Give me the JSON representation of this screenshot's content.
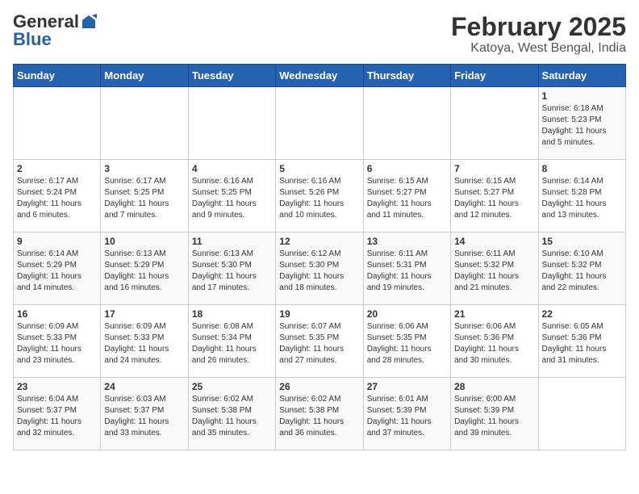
{
  "logo": {
    "general": "General",
    "blue": "Blue"
  },
  "title": "February 2025",
  "subtitle": "Katoya, West Bengal, India",
  "days_header": [
    "Sunday",
    "Monday",
    "Tuesday",
    "Wednesday",
    "Thursday",
    "Friday",
    "Saturday"
  ],
  "weeks": [
    [
      {
        "day": "",
        "info": ""
      },
      {
        "day": "",
        "info": ""
      },
      {
        "day": "",
        "info": ""
      },
      {
        "day": "",
        "info": ""
      },
      {
        "day": "",
        "info": ""
      },
      {
        "day": "",
        "info": ""
      },
      {
        "day": "1",
        "info": "Sunrise: 6:18 AM\nSunset: 5:23 PM\nDaylight: 11 hours\nand 5 minutes."
      }
    ],
    [
      {
        "day": "2",
        "info": "Sunrise: 6:17 AM\nSunset: 5:24 PM\nDaylight: 11 hours\nand 6 minutes."
      },
      {
        "day": "3",
        "info": "Sunrise: 6:17 AM\nSunset: 5:25 PM\nDaylight: 11 hours\nand 7 minutes."
      },
      {
        "day": "4",
        "info": "Sunrise: 6:16 AM\nSunset: 5:25 PM\nDaylight: 11 hours\nand 9 minutes."
      },
      {
        "day": "5",
        "info": "Sunrise: 6:16 AM\nSunset: 5:26 PM\nDaylight: 11 hours\nand 10 minutes."
      },
      {
        "day": "6",
        "info": "Sunrise: 6:15 AM\nSunset: 5:27 PM\nDaylight: 11 hours\nand 11 minutes."
      },
      {
        "day": "7",
        "info": "Sunrise: 6:15 AM\nSunset: 5:27 PM\nDaylight: 11 hours\nand 12 minutes."
      },
      {
        "day": "8",
        "info": "Sunrise: 6:14 AM\nSunset: 5:28 PM\nDaylight: 11 hours\nand 13 minutes."
      }
    ],
    [
      {
        "day": "9",
        "info": "Sunrise: 6:14 AM\nSunset: 5:29 PM\nDaylight: 11 hours\nand 14 minutes."
      },
      {
        "day": "10",
        "info": "Sunrise: 6:13 AM\nSunset: 5:29 PM\nDaylight: 11 hours\nand 16 minutes."
      },
      {
        "day": "11",
        "info": "Sunrise: 6:13 AM\nSunset: 5:30 PM\nDaylight: 11 hours\nand 17 minutes."
      },
      {
        "day": "12",
        "info": "Sunrise: 6:12 AM\nSunset: 5:30 PM\nDaylight: 11 hours\nand 18 minutes."
      },
      {
        "day": "13",
        "info": "Sunrise: 6:11 AM\nSunset: 5:31 PM\nDaylight: 11 hours\nand 19 minutes."
      },
      {
        "day": "14",
        "info": "Sunrise: 6:11 AM\nSunset: 5:32 PM\nDaylight: 11 hours\nand 21 minutes."
      },
      {
        "day": "15",
        "info": "Sunrise: 6:10 AM\nSunset: 5:32 PM\nDaylight: 11 hours\nand 22 minutes."
      }
    ],
    [
      {
        "day": "16",
        "info": "Sunrise: 6:09 AM\nSunset: 5:33 PM\nDaylight: 11 hours\nand 23 minutes."
      },
      {
        "day": "17",
        "info": "Sunrise: 6:09 AM\nSunset: 5:33 PM\nDaylight: 11 hours\nand 24 minutes."
      },
      {
        "day": "18",
        "info": "Sunrise: 6:08 AM\nSunset: 5:34 PM\nDaylight: 11 hours\nand 26 minutes."
      },
      {
        "day": "19",
        "info": "Sunrise: 6:07 AM\nSunset: 5:35 PM\nDaylight: 11 hours\nand 27 minutes."
      },
      {
        "day": "20",
        "info": "Sunrise: 6:06 AM\nSunset: 5:35 PM\nDaylight: 11 hours\nand 28 minutes."
      },
      {
        "day": "21",
        "info": "Sunrise: 6:06 AM\nSunset: 5:36 PM\nDaylight: 11 hours\nand 30 minutes."
      },
      {
        "day": "22",
        "info": "Sunrise: 6:05 AM\nSunset: 5:36 PM\nDaylight: 11 hours\nand 31 minutes."
      }
    ],
    [
      {
        "day": "23",
        "info": "Sunrise: 6:04 AM\nSunset: 5:37 PM\nDaylight: 11 hours\nand 32 minutes."
      },
      {
        "day": "24",
        "info": "Sunrise: 6:03 AM\nSunset: 5:37 PM\nDaylight: 11 hours\nand 33 minutes."
      },
      {
        "day": "25",
        "info": "Sunrise: 6:02 AM\nSunset: 5:38 PM\nDaylight: 11 hours\nand 35 minutes."
      },
      {
        "day": "26",
        "info": "Sunrise: 6:02 AM\nSunset: 5:38 PM\nDaylight: 11 hours\nand 36 minutes."
      },
      {
        "day": "27",
        "info": "Sunrise: 6:01 AM\nSunset: 5:39 PM\nDaylight: 11 hours\nand 37 minutes."
      },
      {
        "day": "28",
        "info": "Sunrise: 6:00 AM\nSunset: 5:39 PM\nDaylight: 11 hours\nand 39 minutes."
      },
      {
        "day": "",
        "info": ""
      }
    ]
  ]
}
